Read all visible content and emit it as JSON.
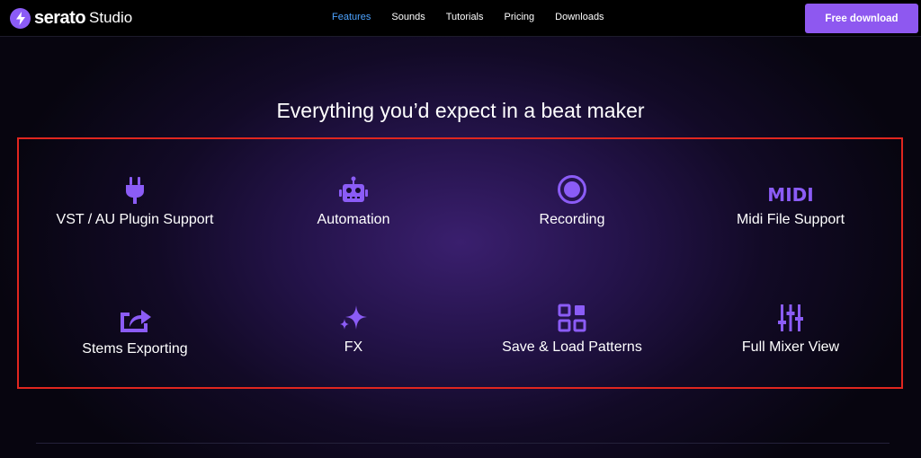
{
  "nav": {
    "logo_word": "serato",
    "logo_product": "Studio",
    "links": [
      {
        "label": "Features",
        "active": true
      },
      {
        "label": "Sounds",
        "active": false
      },
      {
        "label": "Tutorials",
        "active": false
      },
      {
        "label": "Pricing",
        "active": false
      },
      {
        "label": "Downloads",
        "active": false
      }
    ],
    "cta_label": "Free download"
  },
  "main": {
    "heading": "Everything you’d expect in a beat maker",
    "features": [
      {
        "label": "VST / AU Plugin Support",
        "icon": "plug-icon"
      },
      {
        "label": "Automation",
        "icon": "robot-icon"
      },
      {
        "label": "Recording",
        "icon": "record-icon"
      },
      {
        "label": "Midi File Support",
        "icon": "midi-icon",
        "icon_text": "MIDI"
      },
      {
        "label": "Stems Exporting",
        "icon": "export-icon"
      },
      {
        "label": "FX",
        "icon": "sparkle-icon"
      },
      {
        "label": "Save & Load Patterns",
        "icon": "grid-icon"
      },
      {
        "label": "Full Mixer View",
        "icon": "mixer-sliders-icon"
      }
    ]
  },
  "colors": {
    "accent": "#8e58f0",
    "icon": "#8b5cf6",
    "active_link": "#4da3ff",
    "highlight_border": "#e0261f"
  }
}
